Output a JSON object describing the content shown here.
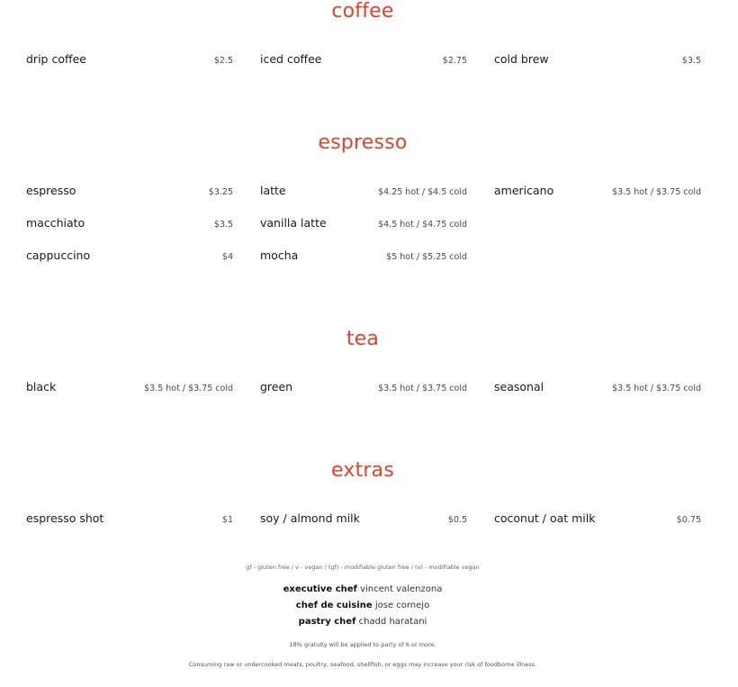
{
  "sections": [
    {
      "title": "coffee",
      "items": [
        {
          "name": "drip coffee",
          "price": "$2.5"
        },
        {
          "name": "iced coffee",
          "price": "$2.75"
        },
        {
          "name": "cold brew",
          "price": "$3.5"
        }
      ]
    },
    {
      "title": "espresso",
      "items": [
        {
          "name": "espresso",
          "price": "$3.25"
        },
        {
          "name": "latte",
          "price": "$4.25 hot / $4.5 cold"
        },
        {
          "name": "americano",
          "price": "$3.5 hot / $3.75 cold"
        },
        {
          "name": "macchiato",
          "price": "$3.5"
        },
        {
          "name": "vanilla latte",
          "price": "$4.5 hot / $4.75 cold"
        },
        {
          "name": "cappuccino",
          "price": "$4"
        },
        {
          "name": "mocha",
          "price": "$5 hot / $5.25 cold"
        }
      ]
    },
    {
      "title": "tea",
      "items": [
        {
          "name": "black",
          "price": "$3.5 hot / $3.75 cold"
        },
        {
          "name": "green",
          "price": "$3.5 hot / $3.75 cold"
        },
        {
          "name": "seasonal",
          "price": "$3.5 hot / $3.75 cold"
        }
      ]
    },
    {
      "title": "extras",
      "items": [
        {
          "name": "espresso shot",
          "price": "$1"
        },
        {
          "name": "soy / almond milk",
          "price": "$0.5"
        },
        {
          "name": "coconut / oat milk",
          "price": "$0.75"
        }
      ]
    }
  ],
  "legend": "gf - gluten free /   v - vegan /  (gf) - modifiable gluten free /  (v) - modifiable vegan",
  "credits": [
    {
      "role": "executive chef",
      "name": "vincent valenzona"
    },
    {
      "role": "chef de cuisine",
      "name": "jose cornejo"
    },
    {
      "role": "pastry chef",
      "name": "chadd haratani"
    }
  ],
  "gratuity_note": "18% gratuity will be applied to party of 6 or more.",
  "health_warning": "Consuming raw or undercooked meats, poultry, seafood, shellfish, or eggs may increase your risk of foodborne illness.",
  "colors": {
    "accent": "#e0432b",
    "text": "#1a1a1a"
  }
}
